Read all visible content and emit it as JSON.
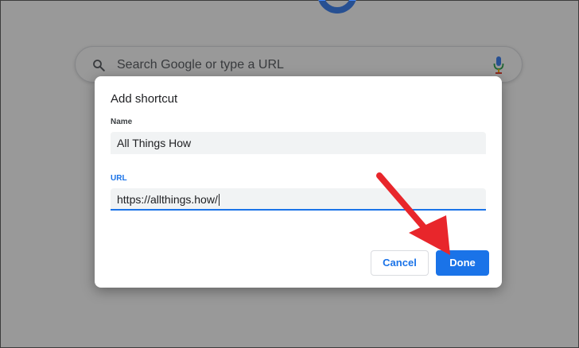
{
  "background": {
    "search_placeholder": "Search Google or type a URL"
  },
  "dialog": {
    "title": "Add shortcut",
    "name_label": "Name",
    "name_value": "All Things How",
    "url_label": "URL",
    "url_value": "https://allthings.how/",
    "cancel_label": "Cancel",
    "done_label": "Done"
  },
  "colors": {
    "accent": "#1a73e8",
    "annotation_arrow": "#e8262b"
  },
  "icons": {
    "search": "search-icon",
    "mic": "mic-icon",
    "annotation": "red-arrow-icon"
  }
}
